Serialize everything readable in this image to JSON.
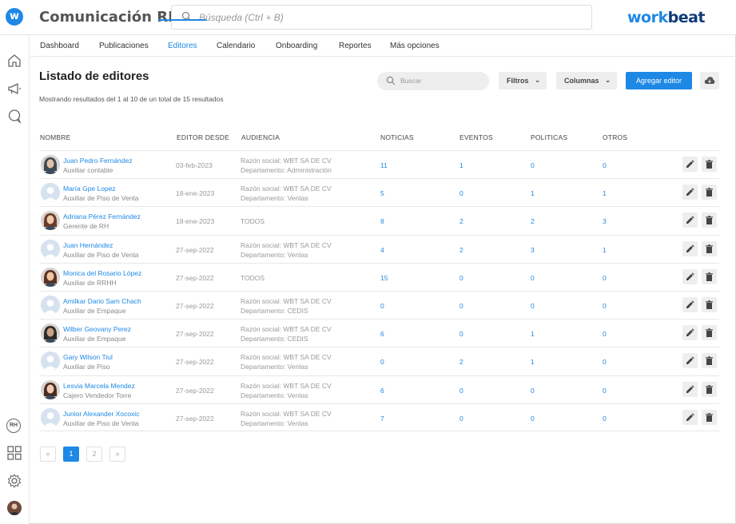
{
  "app": {
    "title": "Comunicación RH",
    "search_placeholder": "Búsqueda (Ctrl + B)",
    "brand_a": "work",
    "brand_b": "beat",
    "accent": "#1e88e5"
  },
  "sidebar": {
    "items": [
      "home-icon",
      "megaphone-icon",
      "chat-icon"
    ],
    "bottom": [
      "rh-icon",
      "grid-icon",
      "gear-icon",
      "avatar"
    ],
    "rh_label": "RH"
  },
  "tabs": [
    {
      "label": "Dashboard",
      "active": false
    },
    {
      "label": "Publicaciones",
      "active": false
    },
    {
      "label": "Editores",
      "active": true
    },
    {
      "label": "Calendario",
      "active": false
    },
    {
      "label": "Onboarding",
      "active": false
    },
    {
      "label": "Reportes",
      "active": false
    },
    {
      "label": "Más opciones",
      "active": false
    }
  ],
  "page": {
    "title": "Listado de editores",
    "results": "Mostrando resultados del 1 al 10 de un total de 15 resultados",
    "search_placeholder": "Buscar",
    "filters_label": "Filtros",
    "columns_label": "Columnas",
    "add_label": "Agregar editor"
  },
  "table": {
    "headers": [
      "NOMBRE",
      "EDITOR DESDE",
      "AUDIENCIA",
      "NOTICIAS",
      "EVENTOS",
      "POLITICAS",
      "OTROS"
    ],
    "rows": [
      {
        "name": "Juan Pedro Fernández",
        "role": "Auxiliar contable",
        "since": "03-feb-2023",
        "aud1": "Razón social: WBT SA DE CV",
        "aud2": "Departamento: Administración",
        "noticias": "11",
        "eventos": "1",
        "politicas": "0",
        "otros": "0",
        "photo": true
      },
      {
        "name": "María Gpe Lopez",
        "role": "Auxiliar de Piso de Venta",
        "since": "18-ene-2023",
        "aud1": "Razón social: WBT SA DE CV",
        "aud2": "Departamento: Ventas",
        "noticias": "5",
        "eventos": "0",
        "politicas": "1",
        "otros": "1",
        "photo": false
      },
      {
        "name": "Adriana Pérez Fernández",
        "role": "Gerente de RH",
        "since": "18-ene-2023",
        "aud1": "TODOS",
        "aud2": "",
        "noticias": "8",
        "eventos": "2",
        "politicas": "2",
        "otros": "3",
        "photo": true
      },
      {
        "name": "Juan Hernández",
        "role": "Auxiliar de Piso de Venta",
        "since": "27-sep-2022",
        "aud1": "Razón social: WBT SA DE CV",
        "aud2": "Departamento: Ventas",
        "noticias": "4",
        "eventos": "2",
        "politicas": "3",
        "otros": "1",
        "photo": false
      },
      {
        "name": "Monica del Rosario López",
        "role": "Auxiliar de RRHH",
        "since": "27-sep-2022",
        "aud1": "TODOS",
        "aud2": "",
        "noticias": "15",
        "eventos": "0",
        "politicas": "0",
        "otros": "0",
        "photo": true
      },
      {
        "name": "Amilkar Dario Sam Chach",
        "role": "Auxiliar de Empaque",
        "since": "27-sep-2022",
        "aud1": "Razón social: WBT SA DE CV",
        "aud2": "Departamento: CEDIS",
        "noticias": "0",
        "eventos": "0",
        "politicas": "0",
        "otros": "0",
        "photo": false
      },
      {
        "name": "Wilber Geovany Perez",
        "role": "Auxiliar de Empaque",
        "since": "27-sep-2022",
        "aud1": "Razón social: WBT SA DE CV",
        "aud2": "Departamento: CEDIS",
        "noticias": "6",
        "eventos": "0",
        "politicas": "1",
        "otros": "0",
        "photo": true
      },
      {
        "name": "Gary Wilson Tiul",
        "role": "Auxiliar de Piso",
        "since": "27-sep-2022",
        "aud1": "Razón social: WBT SA DE CV",
        "aud2": "Departamento: Ventas",
        "noticias": "0",
        "eventos": "2",
        "politicas": "1",
        "otros": "0",
        "photo": false
      },
      {
        "name": "Lesvia Marcela Mendez",
        "role": "Cajero Vendedor Torre",
        "since": "27-sep-2022",
        "aud1": "Razón social: WBT SA DE CV",
        "aud2": "Departamento: Ventas",
        "noticias": "6",
        "eventos": "0",
        "politicas": "0",
        "otros": "0",
        "photo": true
      },
      {
        "name": "Junior Alexander Xocoxic",
        "role": "Auxiliar de Piso de Venta",
        "since": "27-sep-2022",
        "aud1": "Razón social: WBT SA DE CV",
        "aud2": "Departamento: Ventas",
        "noticias": "7",
        "eventos": "0",
        "politicas": "0",
        "otros": "0",
        "photo": false
      }
    ]
  },
  "pagination": {
    "first": "«",
    "pages": [
      "1",
      "2"
    ],
    "current": "1",
    "last": "»"
  }
}
